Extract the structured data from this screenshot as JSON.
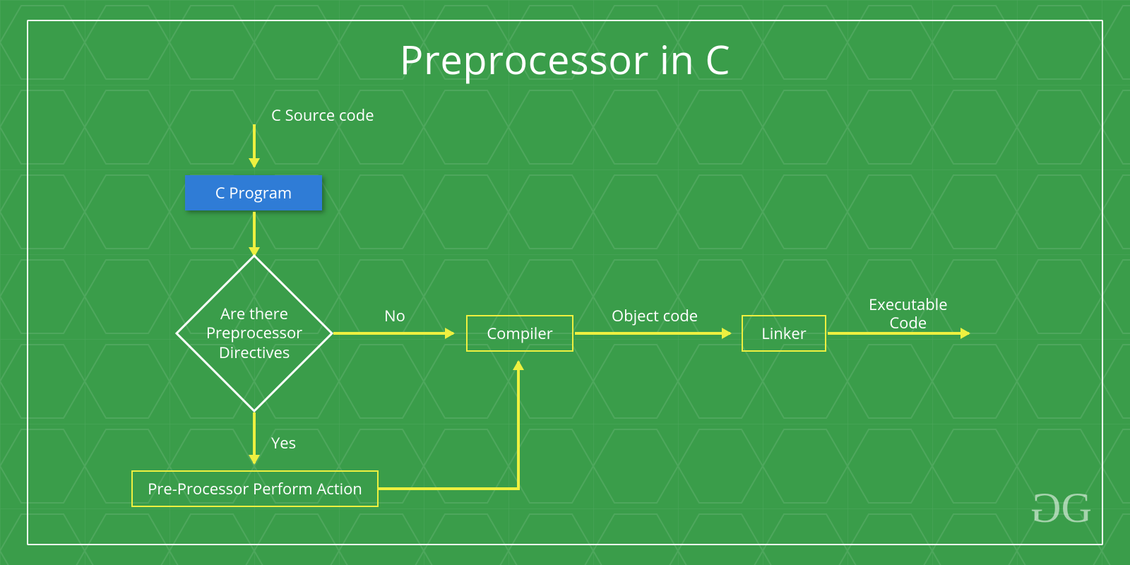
{
  "title": "Preprocessor in C",
  "labels": {
    "source": "C Source code",
    "no": "No",
    "yes": "Yes",
    "objectcode": "Object code",
    "executable": "Executable\nCode"
  },
  "nodes": {
    "cprogram": "C Program",
    "decision": "Are there\nPreprocessor\nDirectives",
    "preprocessor_action": "Pre-Processor Perform Action",
    "compiler": "Compiler",
    "linker": "Linker"
  },
  "logo": "GG",
  "colors": {
    "bg": "#3a9d4a",
    "accent": "#eef040",
    "blue": "#2f7cd6",
    "white": "#ffffff"
  }
}
